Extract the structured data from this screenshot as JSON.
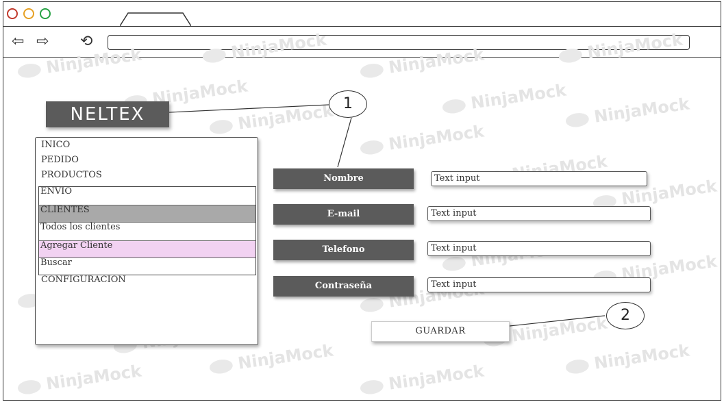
{
  "logo": {
    "text": "NELTEX"
  },
  "callouts": [
    "1",
    "2"
  ],
  "watermark": "NinjaMock",
  "menu": {
    "top_items": [
      "INICO",
      "PEDIDO",
      "PRODUCTOS"
    ],
    "submenu": [
      "ENVIO",
      "CLIENTES",
      "Todos los clientes",
      "Agregar Cliente",
      "Buscar"
    ],
    "bottom_items": [
      "CONFIGURACION"
    ]
  },
  "form": {
    "fields": [
      {
        "label": "Nombre",
        "value": "Text input"
      },
      {
        "label": "E-mail",
        "value": "Text input"
      },
      {
        "label": "Telefono",
        "value": "Text input"
      },
      {
        "label": "Contraseña",
        "value": "Text input"
      }
    ],
    "save_label": "GUARDAR"
  },
  "colors": {
    "traffic_red": "#c0392b",
    "traffic_yellow": "#e6a023",
    "traffic_green": "#27a244",
    "dark_label": "#5b5b5b",
    "selected_row": "#a9a9a9",
    "highlight_row": "#f2d2f2"
  }
}
